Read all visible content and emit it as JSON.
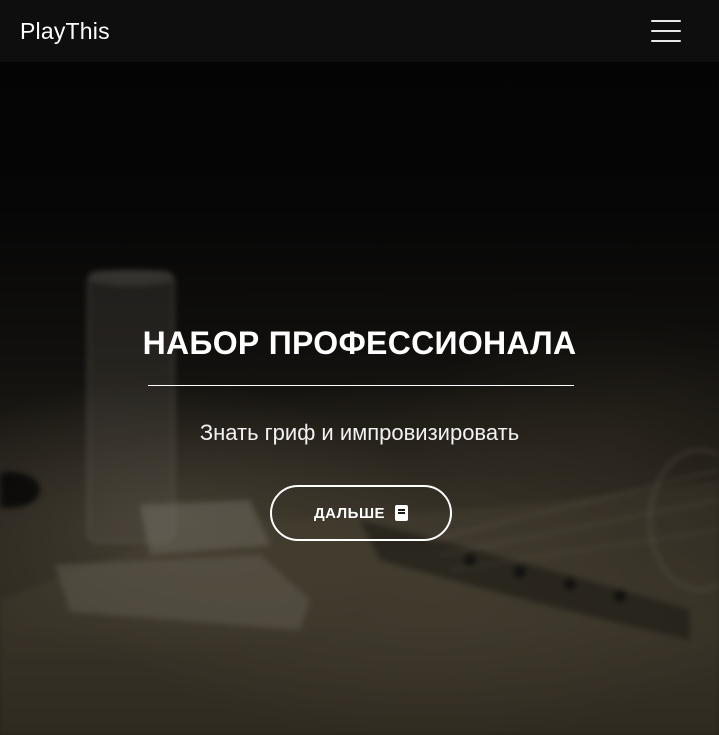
{
  "navbar": {
    "brand": "PlayThis",
    "menu_icon": "hamburger-menu-icon"
  },
  "hero": {
    "title": "НАБОР ПРОФЕССИОНАЛА",
    "subtitle": "Знать гриф и импровизировать",
    "cta_label": "ДАЛЬШЕ",
    "cta_icon": "book-icon"
  },
  "colors": {
    "navbar_bg": "#0e0e0e",
    "text": "#ffffff",
    "button_border": "#ffffff"
  }
}
